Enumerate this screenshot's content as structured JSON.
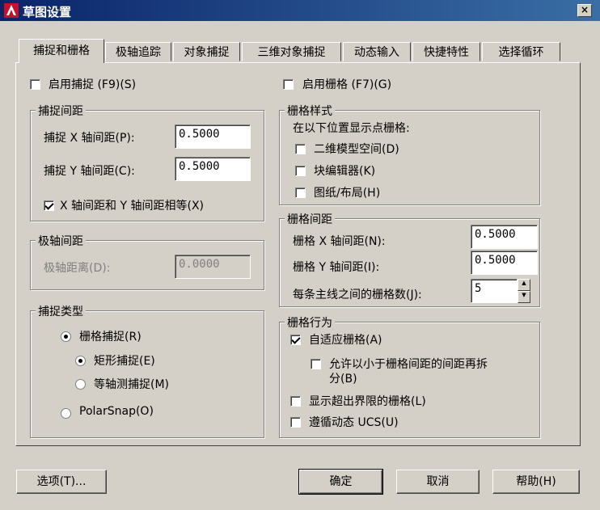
{
  "window": {
    "title": "草图设置",
    "close_label": "×"
  },
  "tabs": [
    "捕捉和栅格",
    "极轴追踪",
    "对象捕捉",
    "三维对象捕捉",
    "动态输入",
    "快捷特性",
    "选择循环"
  ],
  "left": {
    "snap_on_label": "启用捕捉 (F9)(S)",
    "snap_spacing": {
      "title": "捕捉间距",
      "x_label": "捕捉 X 轴间距(P):",
      "x_value": "0.5000",
      "y_label": "捕捉 Y 轴间距(C):",
      "y_value": "0.5000",
      "equal_label": "X 轴间距和 Y 轴间距相等(X)"
    },
    "polar_spacing": {
      "title": "极轴间距",
      "distance_label": "极轴距离(D):",
      "distance_value": "0.0000"
    },
    "snap_type": {
      "title": "捕捉类型",
      "grid_snap_label": "栅格捕捉(R)",
      "rect_label": "矩形捕捉(E)",
      "iso_label": "等轴测捕捉(M)",
      "polar_label": "PolarSnap(O)"
    }
  },
  "right": {
    "grid_on_label": "启用栅格 (F7)(G)",
    "grid_style": {
      "title": "栅格样式",
      "subtitle": "在以下位置显示点栅格:",
      "model_label": "二维模型空间(D)",
      "block_label": "块编辑器(K)",
      "layout_label": "图纸/布局(H)"
    },
    "grid_spacing": {
      "title": "栅格间距",
      "x_label": "栅格 X 轴间距(N):",
      "x_value": "0.5000",
      "y_label": "栅格 Y 轴间距(I):",
      "y_value": "0.5000",
      "major_label": "每条主线之间的栅格数(J):",
      "major_value": "5"
    },
    "grid_behavior": {
      "title": "栅格行为",
      "adaptive_label": "自适应栅格(A)",
      "subdivide_label_1": "允许以小于栅格间距的间距再拆",
      "subdivide_label_2": "分(B)",
      "beyond_label": "显示超出界限的栅格(L)",
      "ucs_label": "遵循动态 UCS(U)"
    }
  },
  "buttons": {
    "options": "选项(T)...",
    "ok": "确定",
    "cancel": "取消",
    "help": "帮助(H)"
  }
}
